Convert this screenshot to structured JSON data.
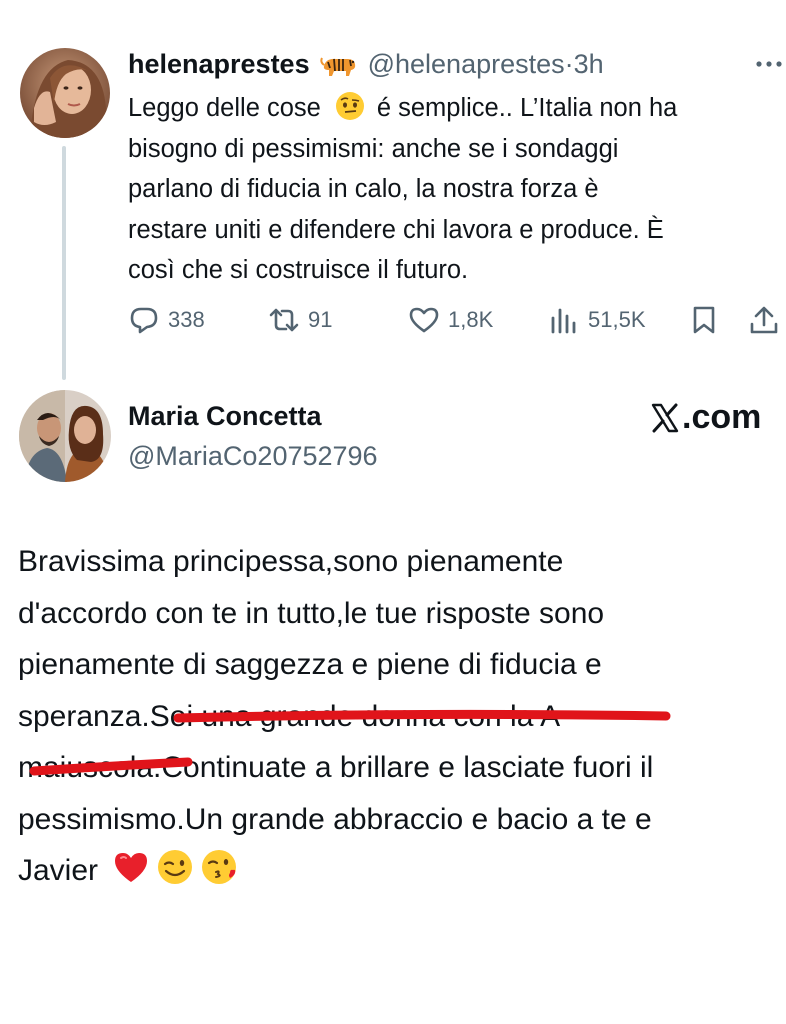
{
  "post": {
    "display_name": "helenaprestes",
    "handle": "@helenaprestes",
    "separator": "·",
    "time": "3h",
    "text_lines": [
      "Leggo delle cose",
      "é semplice.. L’Italia non ha",
      "bisogno di pessimismi: anche se i sondaggi",
      "parlano di fiducia in calo, la nostra forza è",
      "restare uniti e difendere chi lavora e produce. È",
      "così che si costruisce il futuro."
    ],
    "stats": {
      "replies": "338",
      "reposts": "91",
      "likes": "1,8K",
      "views": "51,5K"
    }
  },
  "reply": {
    "display_name": "Maria Concetta",
    "handle": "@MariaCo20752796",
    "brand": ".com",
    "text_lines": [
      "Bravissima principessa,sono pienamente",
      "d'accordo con te in tutto,le tue risposte sono",
      "pienamente di saggezza e piene di fiducia e",
      "speranza.Sei una grande donna con la A",
      "maiuscola.Continuate a brillare e lasciate fuori il",
      "pessimismo.Un grande abbraccio e bacio a te e",
      "Javier"
    ]
  },
  "icons": {
    "reply": "speech-bubble-icon",
    "repost": "repost-arrows-icon",
    "like": "heart-outline-icon",
    "views": "bar-chart-icon",
    "bookmark": "bookmark-icon",
    "share": "share-upload-icon",
    "more": "three-dots-icon",
    "tiger": "tiger-emoji",
    "raised_eyebrow": "face-with-raised-eyebrow-emoji",
    "heart": "red-heart-emoji",
    "wink": "winking-face-emoji",
    "kiss": "face-blowing-kiss-emoji"
  },
  "colors": {
    "text": "#0f1419",
    "secondary": "#536471",
    "thread_line": "#cfd9de",
    "underline_annotation": "#e0141a"
  }
}
